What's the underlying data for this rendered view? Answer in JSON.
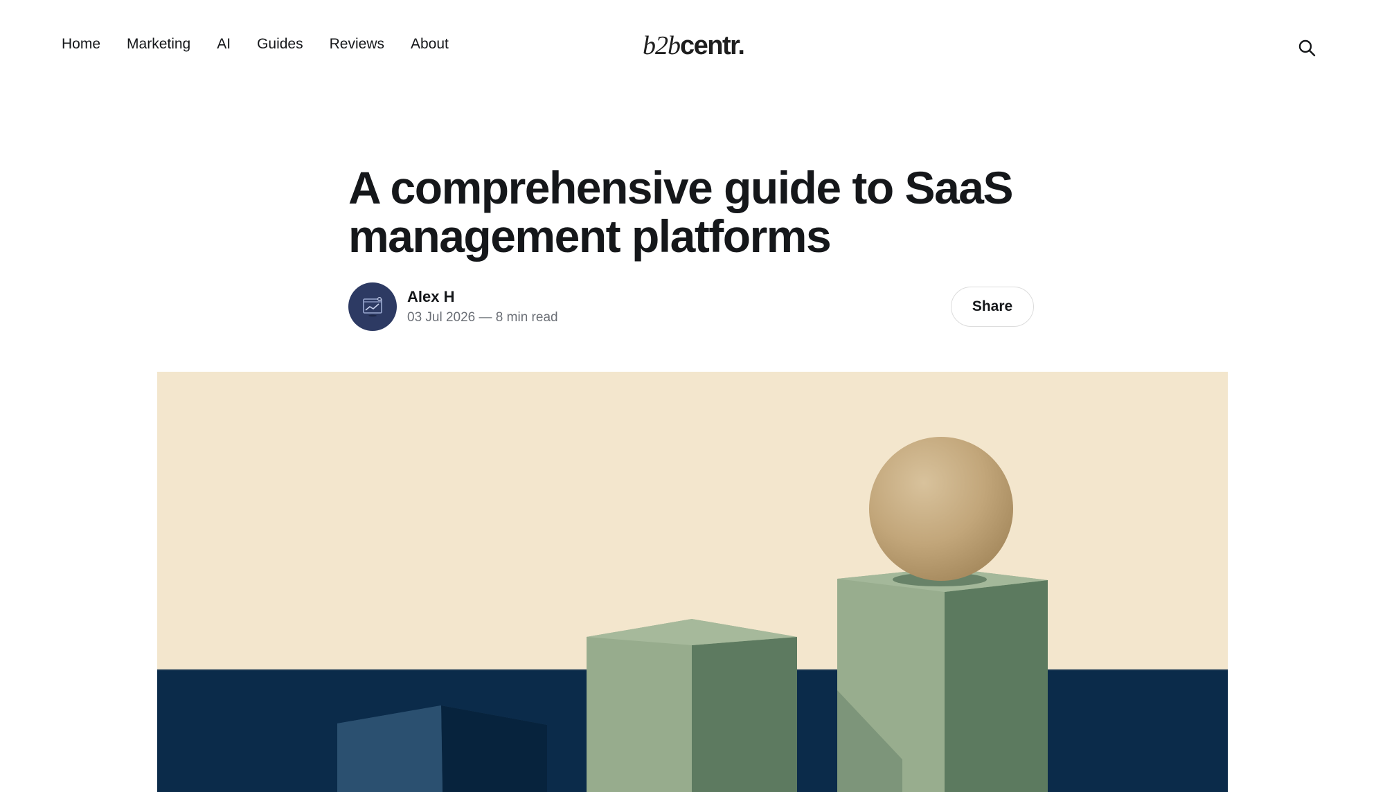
{
  "nav": {
    "items": [
      {
        "label": "Home"
      },
      {
        "label": "Marketing"
      },
      {
        "label": "AI"
      },
      {
        "label": "Guides"
      },
      {
        "label": "Reviews"
      },
      {
        "label": "About"
      }
    ]
  },
  "brand": {
    "logo_light": "b2b",
    "logo_bold": "centr."
  },
  "article": {
    "title": "A comprehensive guide to SaaS management platforms",
    "author": "Alex H",
    "meta": "03 Jul 2026 — 8 min read",
    "share_label": "Share"
  },
  "colors": {
    "text": "#15171a",
    "muted": "#6b6f76",
    "avatar_bg": "#2d3a63",
    "hero_sky": "#f3e6cd",
    "hero_sea": "#0b2b4a",
    "block_green_light": "#97ac8d",
    "block_green_dark": "#5c7a5f",
    "sphere": "#c4a97e"
  },
  "icons": {
    "search": "search-icon",
    "avatar": "chart-frame-icon"
  }
}
